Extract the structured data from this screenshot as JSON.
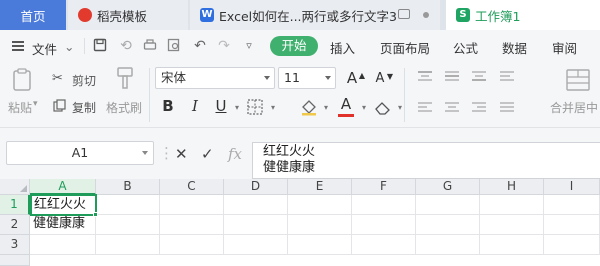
{
  "tabs": {
    "home": "首页",
    "docer": "稻壳模板",
    "excel_doc": "Excel如何在...两行或多行文字3",
    "workbook": "工作簿1"
  },
  "menu": {
    "file": "文件",
    "ribbon_tabs": [
      "开始",
      "插入",
      "页面布局",
      "公式",
      "数据",
      "审阅"
    ]
  },
  "ribbon": {
    "paste": "粘贴",
    "cut": "剪切",
    "copy": "复制",
    "format_painter": "格式刷",
    "font_name": "宋体",
    "font_size": "11",
    "bold": "B",
    "italic": "I",
    "underline": "U",
    "font_color_glyph": "A",
    "merge_center": "合并居中",
    "font_grow": "A",
    "font_shrink": "A"
  },
  "formula_bar": {
    "cell_ref": "A1",
    "fx": "fx",
    "content_line1": "红红火火",
    "content_line2": "健健康康"
  },
  "grid": {
    "columns": [
      "A",
      "B",
      "C",
      "D",
      "E",
      "F",
      "G",
      "H",
      "I"
    ],
    "rows": [
      "1",
      "2",
      "3"
    ],
    "cells": {
      "A1": "红红火火",
      "A2": "健健康康"
    }
  },
  "colors": {
    "accent_green": "#1f9c5a",
    "home_tab_blue": "#4a7bdb",
    "start_button_green": "#3fb06e"
  }
}
